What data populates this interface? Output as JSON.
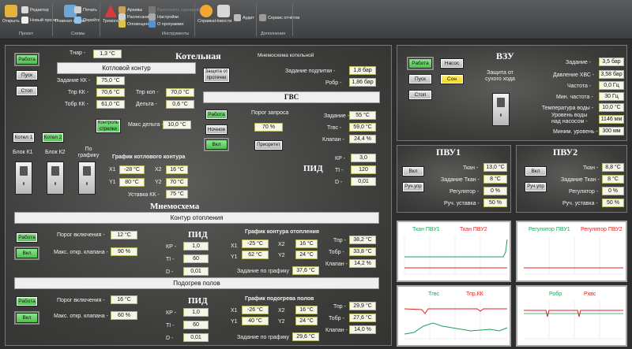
{
  "ribbon": {
    "open": "Открыть",
    "editor": "Редактор",
    "new_project": "Новый проект",
    "project_group": "Проект",
    "main_scheme": "Главная схема",
    "print": "Печать",
    "schemes": "Перейти",
    "schemes_group": "Схемы",
    "alarms": "Тревоги",
    "archives": "Архивы",
    "schedule": "Расписание",
    "notify": "Оповещение",
    "disabled1": "Выполнить сценарий",
    "settings": "Настройки",
    "about": "О программе",
    "tools_group": "Инструменты",
    "help": "Справка",
    "news": "Новости",
    "audit": "Аудит",
    "report_service": "Сервис отчётов",
    "admin_group": "Дополнения"
  },
  "boiler": {
    "title": "Котельная",
    "tnar_label": "Тнар -",
    "tnar": "1,3 °C",
    "mnemo_title": "Мнемосхема котельной",
    "circuit_title": "Котловой контур",
    "work": "Работа",
    "start": "Пуск",
    "stop": "Стоп",
    "zadanie_kk_label": "Задание КК -",
    "zadanie_kk": "75,0 °C",
    "tpr_kk_label": "Тпр КК -",
    "tpr_kk": "70,6 °C",
    "tobr_kk_label": "Тобр КК -",
    "tobr_kk": "61,0 °C",
    "tpr_kop_label": "Тпр коп -",
    "tpr_kop": "70,0 °C",
    "delta_label": "Дельта -",
    "delta": "0,6 °C",
    "maks_delta_label": "Макс дельта -",
    "maks_delta": "10,0 °C",
    "arrow_control": "Контроль стрелки",
    "protect_leak": "Защита от протечки",
    "zad_podpitki_label": "Задание подпитки -",
    "zad_podpitki": "1,8 бар",
    "robr_label": "Робр -",
    "robr": "1,86 бар",
    "kotel1": "Котел 1",
    "kotel2": "Котел 2",
    "blok1": "Блок К1",
    "blok2": "Блок К2",
    "po_grafiku": "По графику",
    "graph_title": "График котлового контура",
    "x1": "X1",
    "x1v": "-28 °C",
    "x2": "X2",
    "x2v": "16 °C",
    "y1": "Y1",
    "y1v": "80 °C",
    "y2": "Y2",
    "y2v": "70 °C",
    "ustavka_kk_label": "Уставка КК -",
    "ustavka_kk": "75 °C"
  },
  "gvs": {
    "title": "ГВС",
    "work": "Работа",
    "night": "Ночное",
    "on": "Вкл",
    "porog_label": "Порог запроса",
    "porog": "70 %",
    "priority": "Приоритет",
    "zadanie_label": "Задание -",
    "zadanie": "55 °C",
    "tgvs_label": "Тгвс -",
    "tgvs": "59,0 °C",
    "klapan_label": "Клапан -",
    "klapan": "24,4 %",
    "pid_title": "ПИД",
    "kp_label": "КР -",
    "kp": "3,0",
    "ti_label": "TI -",
    "ti": "120",
    "d_label": "D -",
    "d": "0,01"
  },
  "mnemo2": {
    "title": "Мнемосхема"
  },
  "heating": {
    "title": "Контур отопления",
    "work": "Работа",
    "on": "Вкл",
    "porog_label": "Порог включения -",
    "porog": "12 °C",
    "maks_label": "Макс. откр. клапана -",
    "maks": "90 %",
    "pid_title": "ПИД",
    "kp_label": "КР -",
    "kp": "1,0",
    "ti_label": "TI -",
    "ti": "60",
    "d_label": "D -",
    "d": "0,01",
    "graph_title": "График контура отопления",
    "x1": "X1",
    "x1v": "-25 °C",
    "x2": "X2",
    "x2v": "16 °C",
    "y1": "Y1",
    "y1v": "62 °C",
    "y2": "Y2",
    "y2v": "24 °C",
    "zad_label": "Задание по графику",
    "zad": "37,6 °C",
    "tpr_label": "Тпр -",
    "tpr": "38,2 °C",
    "tobr_label": "Тобр -",
    "tobr": "33,8 °C",
    "klapan_label": "Клапан -",
    "klapan": "14,2 %"
  },
  "floor": {
    "title": "Подогрев полов",
    "work": "Работа",
    "on": "Вкл",
    "porog_label": "Порог включения -",
    "porog": "16 °C",
    "maks_label": "Макс. откр. клапана -",
    "maks": "60 %",
    "pid_title": "ПИД",
    "kp_label": "КР -",
    "kp": "1,0",
    "ti_label": "TI -",
    "ti": "60",
    "d_label": "D -",
    "d": "0,01",
    "graph_title": "График подогрева полов",
    "x1": "X1",
    "x1v": "-26 °C",
    "x2": "X2",
    "x2v": "16 °C",
    "y1": "Y1",
    "y1v": "40 °C",
    "y2": "Y2",
    "y2v": "24 °C",
    "zad_label": "Задание по графику",
    "zad": "29,6 °C",
    "tpr_label": "Тпр -",
    "tpr": "29,9 °C",
    "tobr_label": "Тобр -",
    "tobr": "27,6 °C",
    "klapan_label": "Клапан -",
    "klapan": "14,0 %"
  },
  "vzu": {
    "title": "ВЗУ",
    "work": "Работа",
    "pump": "Насос",
    "start": "Пуск",
    "sleep": "Сон",
    "stop": "Стоп",
    "dry_run": "Защита от сухого хода",
    "zadanie_label": "Задание -",
    "zadanie": "3,5 бар",
    "davl_label": "Давление ХВС -",
    "davl": "3,58 бар",
    "chastota_label": "Частота -",
    "chastota": "0,0 Гц",
    "min_ch_label": "Мин. частота -",
    "min_ch": "30 Гц",
    "temp_label": "Температура воды -",
    "temp": "10,0 °C",
    "uroven_label1": "Уровень воды",
    "uroven_label2": "над насосом -",
    "uroven": "1146 мм",
    "min_ur_label": "Миним. уровень -",
    "min_ur": "300 мм"
  },
  "pvu1": {
    "title": "ПВУ1",
    "on": "Вкл",
    "manual": "Руч.упр",
    "tkan_label": "Ткан -",
    "tkan": "13,0 °C",
    "zad_label": "Задание Ткан -",
    "zad": "8 °C",
    "reg_label": "Регулятор -",
    "reg": "0 %",
    "ruch_label": "Руч. уставка -",
    "ruch": "50 %"
  },
  "pvu2": {
    "title": "ПВУ2",
    "on": "Вкл",
    "manual": "Руч.упр",
    "tkan_label": "Ткан -",
    "tkan": "8,8 °C",
    "zad_label": "Задание Ткан -",
    "zad": "8 °C",
    "reg_label": "Регулятор -",
    "reg": "0 %",
    "ruch_label": "Руч. уставка -",
    "ruch": "50 %"
  },
  "charts": {
    "c1": {
      "s1": "Ткан ПВУ1",
      "s2": "Ткан ПВУ2"
    },
    "c2": {
      "s1": "Регулятор  ПВУ1",
      "s2": "Регулятор ПВУ2"
    },
    "c3": {
      "s1": "Тгвс",
      "s2": "Тпр.КК"
    },
    "c4": {
      "s1": "Робр",
      "s2": "Рхвс"
    }
  },
  "colors": {
    "green_btn": "#5fcf5f",
    "yellow_btn": "#f5dc2a",
    "series_green": "#1e9e5a",
    "series_red": "#e02020"
  }
}
